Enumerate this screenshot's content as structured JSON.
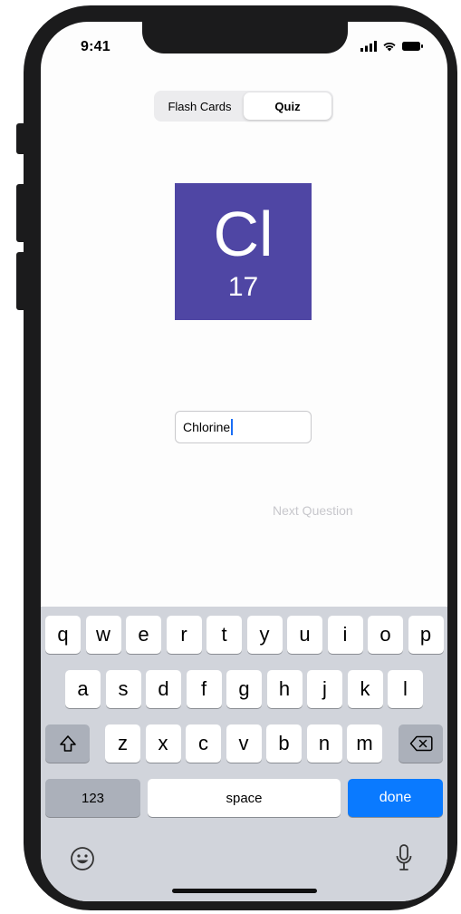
{
  "status_bar": {
    "time": "9:41"
  },
  "segmented_control": {
    "options": [
      "Flash Cards",
      "Quiz"
    ],
    "selected": "Quiz"
  },
  "element_card": {
    "symbol": "Cl",
    "atomic_number": "17",
    "color": "#4f46a4"
  },
  "answer_field": {
    "value": "Chlorine"
  },
  "next_question_label": "Next Question",
  "keyboard": {
    "row1": [
      "q",
      "w",
      "e",
      "r",
      "t",
      "y",
      "u",
      "i",
      "o",
      "p"
    ],
    "row2": [
      "a",
      "s",
      "d",
      "f",
      "g",
      "h",
      "j",
      "k",
      "l"
    ],
    "row3": [
      "z",
      "x",
      "c",
      "v",
      "b",
      "n",
      "m"
    ],
    "numbers_label": "123",
    "space_label": "space",
    "done_label": "done",
    "done_color": "#0a7aff"
  }
}
